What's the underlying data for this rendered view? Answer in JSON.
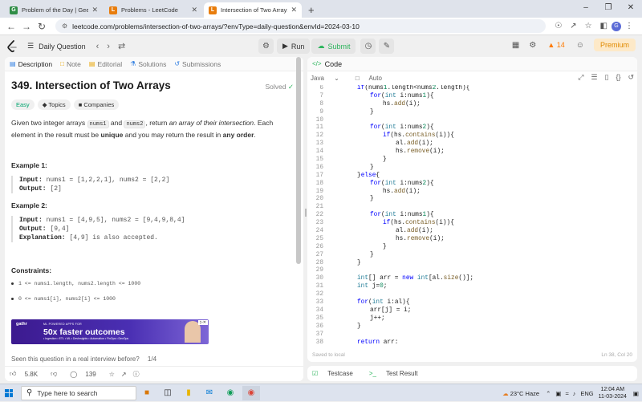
{
  "browser": {
    "tabs": [
      {
        "title": "Problem of the Day | GeeksforG",
        "color": "#2f8d46",
        "glyph": "G",
        "active": false
      },
      {
        "title": "Problems - LeetCode",
        "color": "#e87d0d",
        "glyph": "L",
        "active": false
      },
      {
        "title": "Intersection of Two Arrays - Le",
        "color": "#e87d0d",
        "glyph": "L",
        "active": true
      }
    ],
    "new_tab": "+",
    "url": "leetcode.com/problems/intersection-of-two-arrays/?envType=daily-question&envId=2024-03-10",
    "profile_initial": "G"
  },
  "header": {
    "daily_label": "Daily Question",
    "run_label": "Run",
    "submit_label": "Submit",
    "streak": "14",
    "premium_label": "Premium"
  },
  "left_tabs": [
    "Description",
    "Note",
    "Editorial",
    "Solutions",
    "Submissions"
  ],
  "problem": {
    "title": "349. Intersection of Two Arrays",
    "status": "Solved",
    "difficulty": "Easy",
    "topics_label": "Topics",
    "companies_label": "Companies",
    "desc_p1": "Given two integer arrays",
    "arg1": "nums1",
    "desc_and": "and",
    "arg2": "nums2",
    "desc_p2": ", return",
    "desc_em": "an array of their intersection",
    "desc_p3": ". Each element in the result must be",
    "desc_unique": "unique",
    "desc_p4": "and you may return the result in",
    "desc_any": "any order",
    "desc_end": ".",
    "ex1_title": "Example 1:",
    "ex1_input_label": "Input:",
    "ex1_input": "nums1 = [1,2,2,1], nums2 = [2,2]",
    "ex1_output_label": "Output:",
    "ex1_output": "[2]",
    "ex2_title": "Example 2:",
    "ex2_input_label": "Input:",
    "ex2_input": "nums1 = [4,9,5], nums2 = [9,4,9,8,4]",
    "ex2_output_label": "Output:",
    "ex2_output": "[9,4]",
    "ex2_expl_label": "Explanation:",
    "ex2_expl": "[4,9] is also accepted.",
    "constraints_title": "Constraints:",
    "constraints": [
      "1 <= nums1.length, nums2.length <= 1000",
      "0 <= nums1[i], nums2[i] <= 1000"
    ],
    "seen_text": "Seen this question in a real interview before?",
    "seen_page": "1/4",
    "likes": "5.8K",
    "comments": "139"
  },
  "ad": {
    "brand": "gathr",
    "sub": "ML POWERED APPS FOR",
    "headline": "50x faster outcomes",
    "features": "• Ingestion • ETL • ML • DevInsights • Automation • FinOps • DevOps"
  },
  "editor": {
    "panel_title": "Code",
    "language": "Java",
    "auto": "Auto",
    "status_left": "Saved to local",
    "status_right": "Ln 38, Col 20",
    "lines": [
      {
        "n": "6",
        "i": 0,
        "t": "if(nums1.length<nums2.length){"
      },
      {
        "n": "7",
        "i": 1,
        "t": "for(int i:nums1){"
      },
      {
        "n": "8",
        "i": 2,
        "t": "hs.add(i);"
      },
      {
        "n": "9",
        "i": 1,
        "t": "}"
      },
      {
        "n": "10",
        "i": 0,
        "t": ""
      },
      {
        "n": "11",
        "i": 1,
        "t": "for(int i:nums2){"
      },
      {
        "n": "12",
        "i": 2,
        "t": "if(hs.contains(i)){"
      },
      {
        "n": "13",
        "i": 3,
        "t": "al.add(i);"
      },
      {
        "n": "14",
        "i": 3,
        "t": "hs.remove(i);"
      },
      {
        "n": "15",
        "i": 2,
        "t": "}"
      },
      {
        "n": "16",
        "i": 1,
        "t": "}"
      },
      {
        "n": "17",
        "i": 0,
        "t": "}else{"
      },
      {
        "n": "18",
        "i": 1,
        "t": "for(int i:nums2){"
      },
      {
        "n": "19",
        "i": 2,
        "t": "hs.add(i);"
      },
      {
        "n": "20",
        "i": 1,
        "t": "}"
      },
      {
        "n": "21",
        "i": 0,
        "t": ""
      },
      {
        "n": "22",
        "i": 1,
        "t": "for(int i:nums1){"
      },
      {
        "n": "23",
        "i": 2,
        "t": "if(hs.contains(i)){"
      },
      {
        "n": "24",
        "i": 3,
        "t": "al.add(i);"
      },
      {
        "n": "25",
        "i": 3,
        "t": "hs.remove(i);"
      },
      {
        "n": "26",
        "i": 2,
        "t": "}"
      },
      {
        "n": "27",
        "i": 1,
        "t": "}"
      },
      {
        "n": "28",
        "i": 0,
        "t": "}"
      },
      {
        "n": "29",
        "i": 0,
        "t": ""
      },
      {
        "n": "30",
        "i": 0,
        "t": "int[] arr = new int[al.size()];"
      },
      {
        "n": "31",
        "i": 0,
        "t": "int j=0;"
      },
      {
        "n": "32",
        "i": 0,
        "t": ""
      },
      {
        "n": "33",
        "i": 0,
        "t": "for(int i:al){"
      },
      {
        "n": "34",
        "i": 1,
        "t": "arr[j] = i;"
      },
      {
        "n": "35",
        "i": 1,
        "t": "j++;"
      },
      {
        "n": "36",
        "i": 0,
        "t": "}"
      },
      {
        "n": "37",
        "i": 0,
        "t": ""
      },
      {
        "n": "38",
        "i": 0,
        "t": "return arr;"
      }
    ]
  },
  "bottom_tabs": {
    "testcase": "Testcase",
    "test_result": "Test Result"
  },
  "taskbar": {
    "search_placeholder": "Type here to search",
    "weather": "23°C  Haze",
    "lang": "ENG",
    "time": "12:04 AM",
    "date": "11-03-2024"
  }
}
